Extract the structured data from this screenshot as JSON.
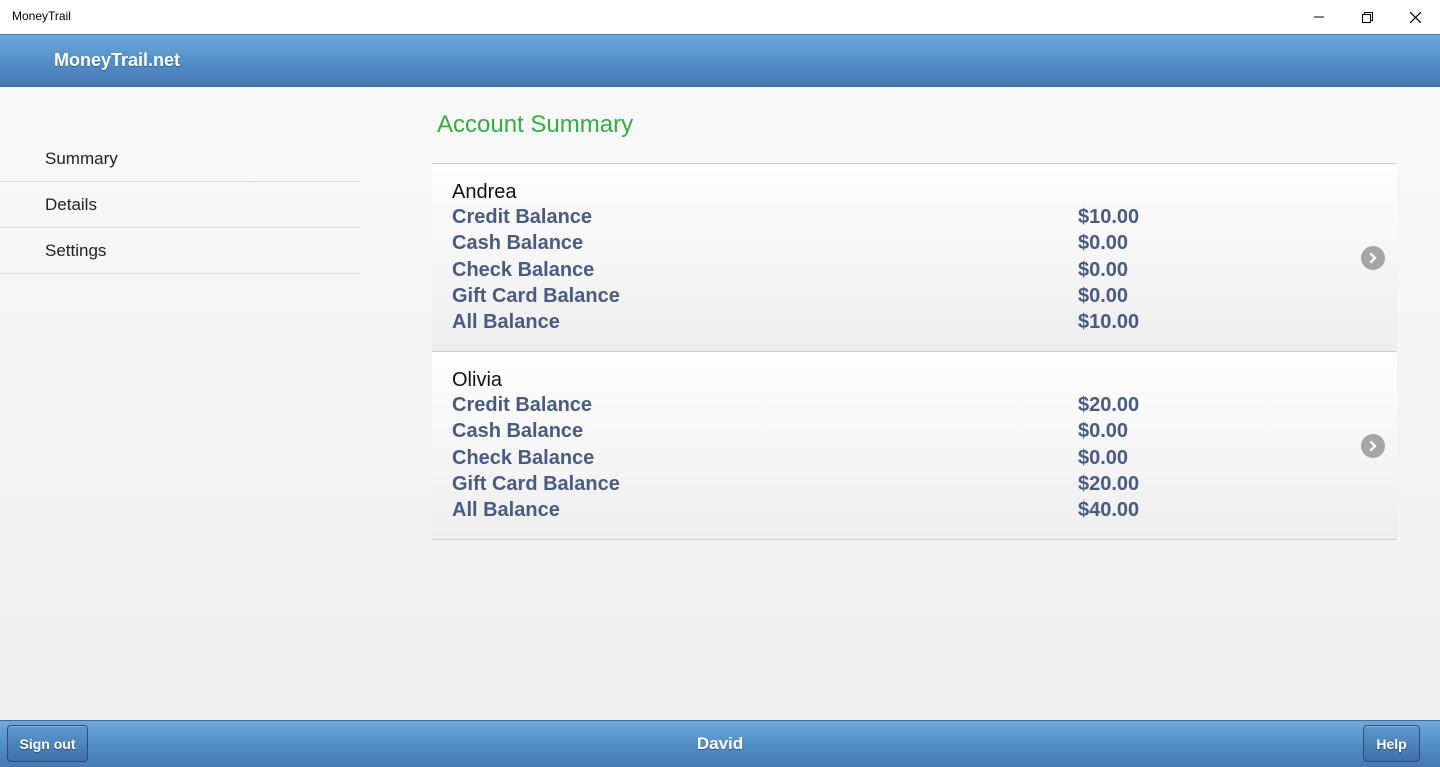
{
  "window": {
    "title": "MoneyTrail"
  },
  "header": {
    "brand": "MoneyTrail.net"
  },
  "sidebar": {
    "items": [
      {
        "label": "Summary"
      },
      {
        "label": "Details"
      },
      {
        "label": "Settings"
      }
    ]
  },
  "main": {
    "title": "Account Summary",
    "accounts": [
      {
        "name": "Andrea",
        "balances": [
          {
            "label": "Credit Balance",
            "value": "$10.00"
          },
          {
            "label": "Cash Balance",
            "value": "$0.00"
          },
          {
            "label": "Check Balance",
            "value": "$0.00"
          },
          {
            "label": "Gift Card Balance",
            "value": "$0.00"
          },
          {
            "label": "All Balance",
            "value": "$10.00"
          }
        ]
      },
      {
        "name": "Olivia",
        "balances": [
          {
            "label": "Credit Balance",
            "value": "$20.00"
          },
          {
            "label": "Cash Balance",
            "value": "$0.00"
          },
          {
            "label": "Check Balance",
            "value": "$0.00"
          },
          {
            "label": "Gift Card Balance",
            "value": "$20.00"
          },
          {
            "label": "All Balance",
            "value": "$40.00"
          }
        ]
      }
    ]
  },
  "footer": {
    "signout_label": "Sign out",
    "user": "David",
    "help_label": "Help"
  },
  "icons": {
    "minimize": "minimize-icon",
    "maximize": "restore-icon",
    "close": "close-icon",
    "chevron": "chevron-right-circle-icon"
  },
  "colors": {
    "accent_title": "#3aaa46",
    "label_text": "#4a5b80",
    "header_blue": "#5290c8"
  }
}
